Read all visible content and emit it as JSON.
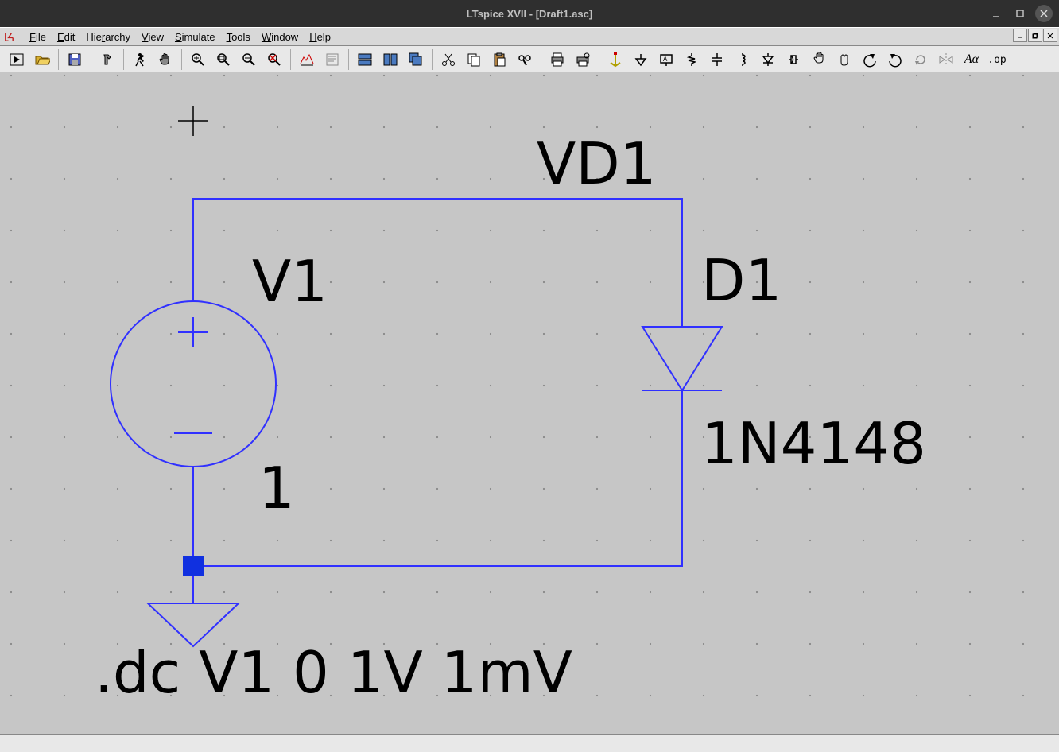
{
  "window": {
    "title": "LTspice XVII - [Draft1.asc]",
    "minimize_tip": "Minimize",
    "maximize_tip": "Maximize",
    "close_tip": "Close"
  },
  "menu": {
    "file": "File",
    "edit": "Edit",
    "hierarchy": "Hierarchy",
    "view": "View",
    "simulate": "Simulate",
    "tools": "Tools",
    "window": "Window",
    "help": "Help"
  },
  "toolbar": {
    "run": "Run",
    "open": "Open",
    "save": "Save",
    "hammer": "Control Panel",
    "person_run": "Run",
    "hand": "Halt",
    "zoom_in": "Zoom In",
    "zoom_pan": "Pan",
    "zoom_out": "Zoom Out",
    "zoom_fit": "Zoom Full",
    "autorange": "Autorange",
    "error_log": "Error Log",
    "tile_h": "Tile Horizontal",
    "tile_v": "Tile Vertical",
    "cascade": "Cascade",
    "cut": "Cut",
    "copy": "Copy",
    "paste": "Paste",
    "find": "Find",
    "print": "Print",
    "print_setup": "Print Setup",
    "wire": "Wire",
    "ground": "Ground",
    "label": "Net Label",
    "resistor": "Resistor",
    "capacitor": "Capacitor",
    "inductor": "Inductor",
    "diode": "Diode",
    "component": "Component",
    "move": "Move",
    "drag": "Drag",
    "undo": "Undo",
    "redo": "Redo",
    "rotate": "Rotate",
    "mirror": "Mirror",
    "text_tool": "Aα",
    "spice_dir": ".op"
  },
  "schematic": {
    "net_label": "VD1",
    "v1_name": "V1",
    "v1_value": "1",
    "d1_name": "D1",
    "d1_value": "1N4148",
    "spice_text": ".dc V1 0 1V 1mV"
  }
}
